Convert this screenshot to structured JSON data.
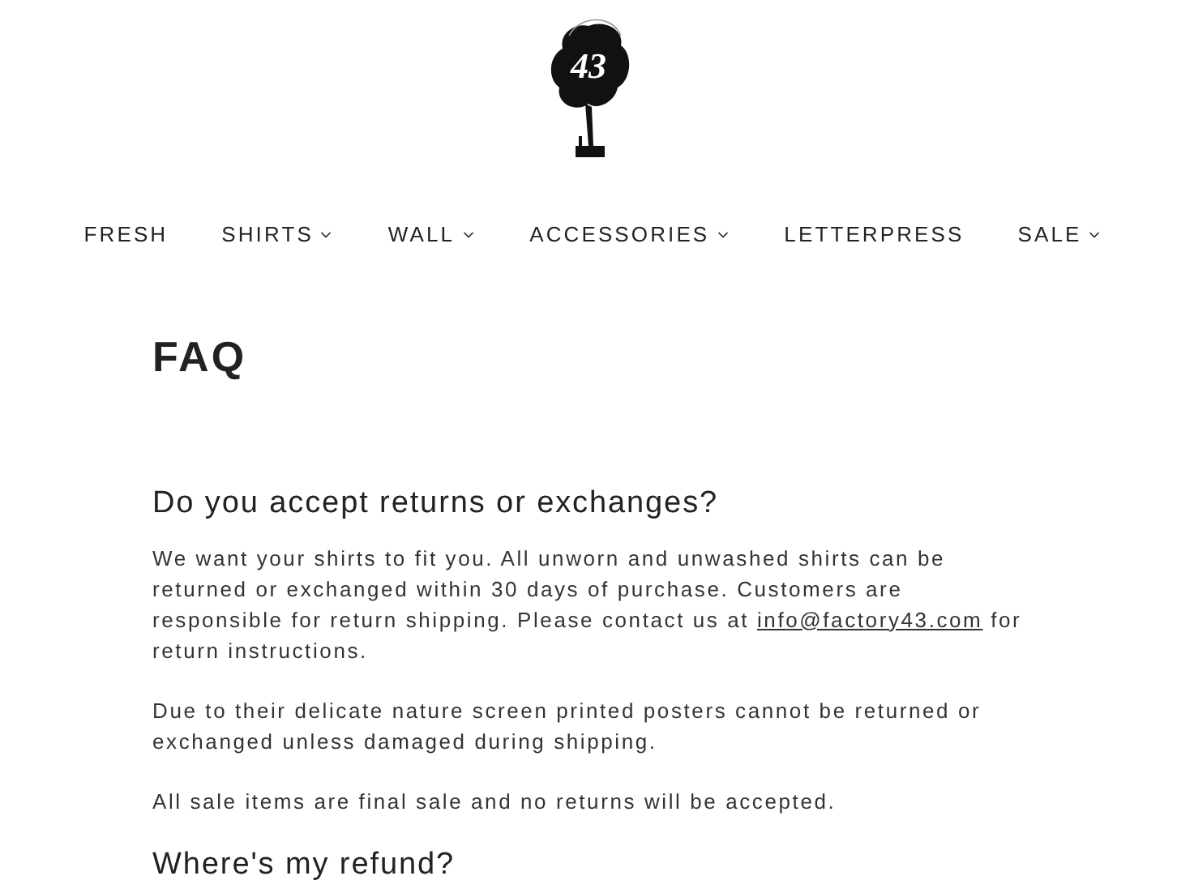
{
  "logo": {
    "text": "43"
  },
  "nav": [
    {
      "label": "FRESH",
      "dropdown": false
    },
    {
      "label": "SHIRTS",
      "dropdown": true
    },
    {
      "label": "WALL",
      "dropdown": true
    },
    {
      "label": "ACCESSORIES",
      "dropdown": true
    },
    {
      "label": "LETTERPRESS",
      "dropdown": false
    },
    {
      "label": "SALE",
      "dropdown": true
    }
  ],
  "page_title": "FAQ",
  "sections": [
    {
      "question": "Do you accept returns or exchanges?",
      "paragraphs": [
        {
          "text": "We want your shirts to fit you. All unworn and unwashed shirts can be returned or exchanged within 30 days of purchase. Customers are responsible for return shipping. Please contact us at ",
          "link": "info@factory43.com",
          "after": " for return instructions."
        },
        {
          "text": "Due to their delicate nature screen printed posters cannot be returned or exchanged unless damaged during shipping."
        },
        {
          "text": "All sale items are final sale and no returns will be accepted."
        }
      ]
    },
    {
      "question": "Where's my refund?"
    }
  ]
}
